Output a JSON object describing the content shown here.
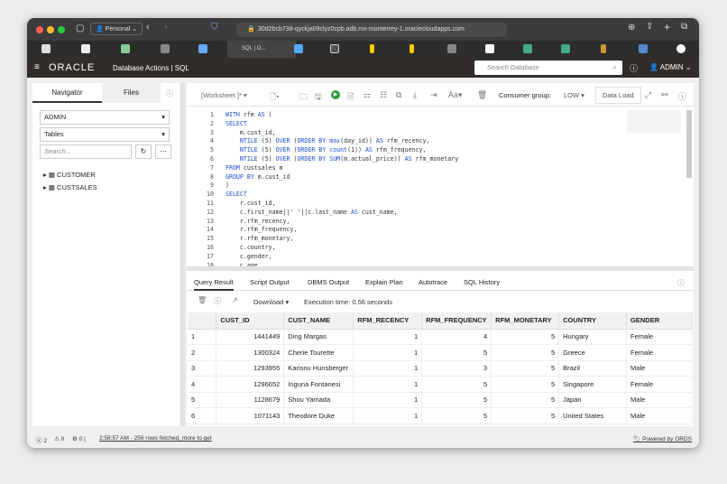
{
  "browser": {
    "profile": "Personal",
    "url": "30d2bcb738-qyckja09clyz0cpb.adb.mx-monterrey-1.oraclecloudapps.com",
    "active_tab": "SQL | O..."
  },
  "header": {
    "logo": "ORACLE",
    "title": "Database Actions | SQL",
    "search_placeholder": "Search Database",
    "user": "ADMIN"
  },
  "navigator": {
    "tabs": [
      "Navigator",
      "Files"
    ],
    "schema": "ADMIN",
    "object_type": "Tables",
    "search_placeholder": "Search...",
    "items": [
      "CUSTOMER",
      "CUSTSALES"
    ]
  },
  "toolbar": {
    "worksheet": "[Worksheet ]*",
    "consumer_group_label": "Consumer group:",
    "consumer_group": "LOW",
    "data_load": "Data Load"
  },
  "editor": {
    "lines": [
      "WITH rfm AS (",
      "SELECT",
      "    m.cust_id,",
      "    NTILE (5) OVER (ORDER BY max(day_id)) AS rfm_recency,",
      "    NTILE (5) OVER (ORDER BY count(1)) AS rfm_frequency,",
      "    NTILE (5) OVER (ORDER BY SUM(m.actual_price)) AS rfm_monetary",
      "FROM custsales m",
      "GROUP BY m.cust_id",
      ")",
      "SELECT",
      "    r.cust_id,",
      "    c.first_name||' '||c.last_name AS cust_name,",
      "    r.rfm_recency,",
      "    r.rfm_frequency,",
      "    r.rfm_monetary,",
      "    c.country,",
      "    c.gender,",
      "    c.age"
    ]
  },
  "results": {
    "tabs": [
      "Query Result",
      "Script Output",
      "DBMS Output",
      "Explain Plan",
      "Autotrace",
      "SQL History"
    ],
    "download": "Download",
    "execution_time": "Execution time: 0.56 seconds",
    "columns": [
      "",
      "CUST_ID",
      "CUST_NAME",
      "RFM_RECENCY",
      "RFM_FREQUENCY",
      "RFM_MONETARY",
      "COUNTRY",
      "GENDER"
    ],
    "rows": [
      [
        "1",
        "1441449",
        "Ding Margas",
        "1",
        "4",
        "5",
        "Hungary",
        "Female"
      ],
      [
        "2",
        "1300324",
        "Cherie Tourette",
        "1",
        "5",
        "5",
        "Greece",
        "Female"
      ],
      [
        "3",
        "1293955",
        "Karisnu Hunsberger",
        "1",
        "3",
        "5",
        "Brazil",
        "Male"
      ],
      [
        "4",
        "1296652",
        "Inguna Fontanesi",
        "1",
        "5",
        "5",
        "Singapore",
        "Female"
      ],
      [
        "5",
        "1128679",
        "Shou Yamada",
        "1",
        "5",
        "5",
        "Japan",
        "Male"
      ],
      [
        "6",
        "1071143",
        "Theodore Duke",
        "1",
        "5",
        "5",
        "United States",
        "Male"
      ]
    ]
  },
  "status": {
    "errors": "2",
    "warnings": "0",
    "settings": "0",
    "message": "2:58:57 AM - 256 rows fetched, more to get",
    "powered": "Powered by ORDS"
  }
}
